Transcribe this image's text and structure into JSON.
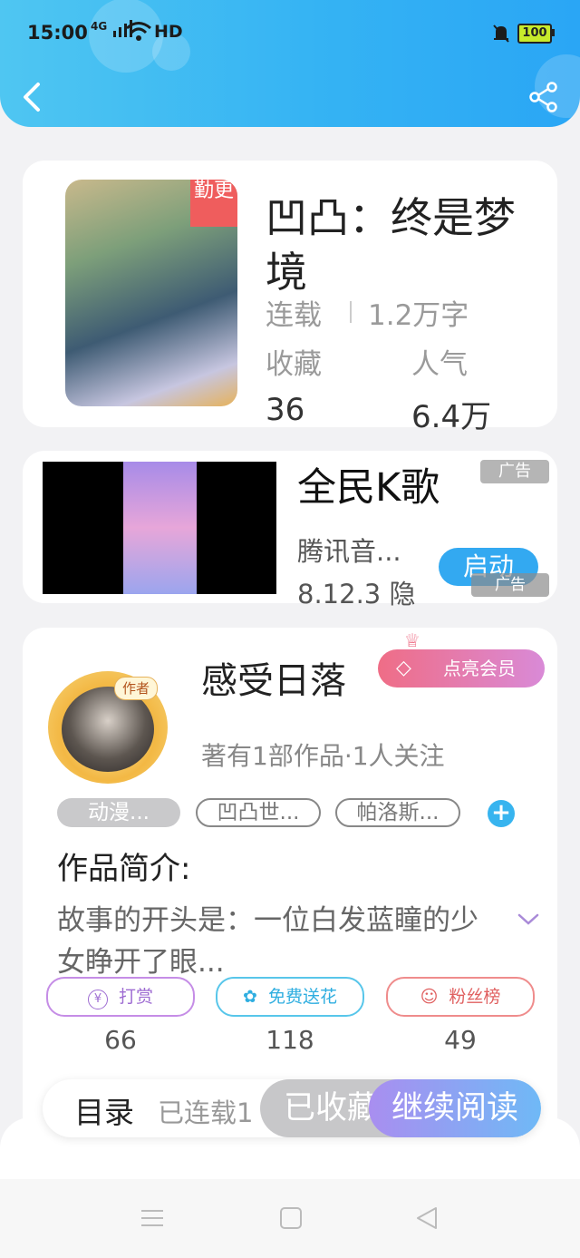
{
  "status_bar": {
    "time": "15:00",
    "signal": "4G",
    "hd": "HD",
    "battery": "100"
  },
  "book": {
    "title": "凹凸：终是梦境",
    "cover_badge": "勤更",
    "status": "连载",
    "word_count": "1.2万字",
    "favorites_label": "收藏",
    "favorites_value": "36",
    "popularity_label": "人气",
    "popularity_value": "6.4万"
  },
  "ad": {
    "title": "全民K歌",
    "tag_top": "广告",
    "tag_bottom": "广告",
    "publisher": "腾讯音...",
    "version": "8.12.3 隐",
    "launch_label": "启动"
  },
  "author": {
    "name": "感受日落",
    "badge": "作者",
    "vip_label": "点亮会员",
    "works_info": "著有1部作品·1人关注",
    "tags": [
      "动漫...",
      "凹凸世...",
      "帕洛斯..."
    ],
    "intro_title": "作品简介:",
    "intro_text": "故事的开头是：一位白发蓝瞳的少女睁开了眼...",
    "actions": {
      "tip_label": "打赏",
      "tip_count": "66",
      "flower_label": "免费送花",
      "flower_count": "118",
      "fans_label": "粉丝榜",
      "fans_count": "49"
    }
  },
  "bottom_bar": {
    "toc_label": "目录",
    "toc_status": "已连载1",
    "collect_label": "已收藏",
    "read_label": "继续阅读"
  },
  "colors": {
    "header_start": "#4fc6f2",
    "header_end": "#2aa6f5",
    "accent_blue": "#33a9f1",
    "vip_pink": "#ef6d86"
  }
}
